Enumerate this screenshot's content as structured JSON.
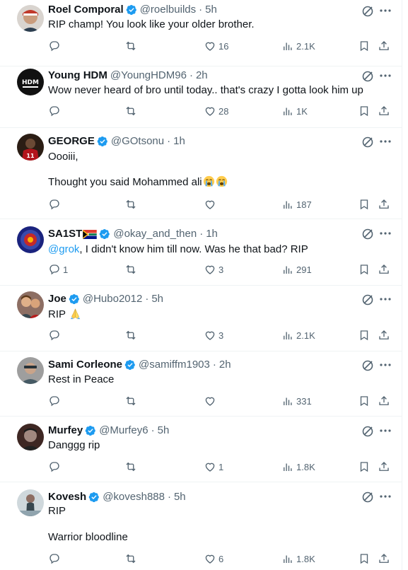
{
  "replies": [
    {
      "name": "Roel Comporal",
      "verified": true,
      "handle": "@roelbuilds",
      "time": "5h",
      "lines": [
        "RIP champ!  You look like your older brother."
      ],
      "replies": "",
      "reposts": "",
      "likes": "16",
      "views": "2.1K"
    },
    {
      "name": "Young HDM",
      "verified": false,
      "handle": "@YoungHDM96",
      "time": "2h",
      "lines": [
        "Wow never heard of bro until today.. that's crazy I gotta look him up"
      ],
      "replies": "",
      "reposts": "",
      "likes": "28",
      "views": "1K",
      "avatar_text": "HDM"
    },
    {
      "name": "GEORGE",
      "verified": true,
      "handle": "@GOtsonu",
      "time": "1h",
      "lines": [
        "Oooiii,",
        "Thought you said Mohammed ali"
      ],
      "replies": "",
      "reposts": "",
      "likes": "",
      "views": "187"
    },
    {
      "name": "SA1ST",
      "verified": true,
      "handle": "@okay_and_then",
      "time": "1h",
      "mention": "@grok",
      "text_after_mention": ", I didn't know him till now. Was he that bad? RIP",
      "replies": "1",
      "reposts": "",
      "likes": "3",
      "views": "291"
    },
    {
      "name": "Joe",
      "verified": true,
      "handle": "@Hubo2012",
      "time": "5h",
      "lines": [
        "RIP"
      ],
      "replies": "",
      "reposts": "",
      "likes": "3",
      "views": "2.1K"
    },
    {
      "name": "Sami Corleone",
      "verified": true,
      "handle": "@samiffm1903",
      "time": "2h",
      "lines": [
        "Rest in Peace"
      ],
      "replies": "",
      "reposts": "",
      "likes": "",
      "views": "331"
    },
    {
      "name": "Murfey",
      "verified": true,
      "handle": "@Murfey6",
      "time": "5h",
      "lines": [
        "Danggg rip"
      ],
      "replies": "",
      "reposts": "",
      "likes": "1",
      "views": "1.8K"
    },
    {
      "name": "Kovesh",
      "verified": true,
      "handle": "@kovesh888",
      "time": "5h",
      "lines": [
        "RIP",
        "Warrior bloodline"
      ],
      "replies": "",
      "reposts": "",
      "likes": "6",
      "views": "1.8K"
    }
  ],
  "separator": "·",
  "colors": {
    "accent": "#1d9bf0",
    "muted": "#536471",
    "text": "#0f1419",
    "border": "#eff3f4"
  },
  "icons": {
    "verified": "verified-badge-icon",
    "grok": "grok-icon",
    "more": "more-icon",
    "reply": "reply-icon",
    "repost": "repost-icon",
    "like": "like-icon",
    "views": "views-icon",
    "bookmark": "bookmark-icon",
    "share": "share-icon",
    "emoji_sob": "loudly-crying-face-icon",
    "emoji_pray": "folded-hands-icon",
    "flag": "south-africa-flag-icon"
  }
}
